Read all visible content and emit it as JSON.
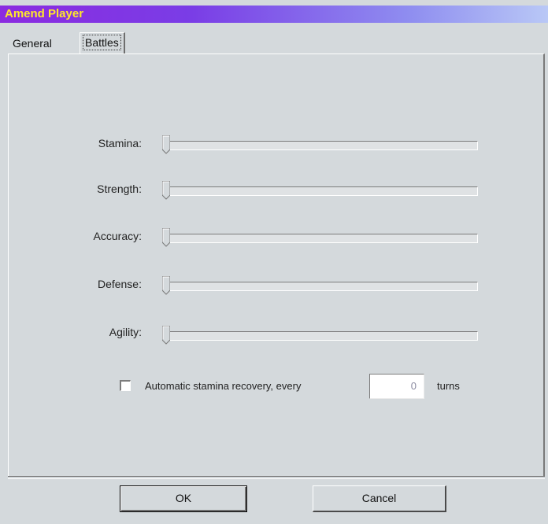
{
  "window": {
    "title": "Amend Player"
  },
  "tabs": [
    {
      "label": "General",
      "selected": false
    },
    {
      "label": "Battles",
      "selected": true
    }
  ],
  "sliders": [
    {
      "label": "Stamina:",
      "value": 0
    },
    {
      "label": "Strength:",
      "value": 0
    },
    {
      "label": "Accuracy:",
      "value": 0
    },
    {
      "label": "Defense:",
      "value": 0
    },
    {
      "label": "Agility:",
      "value": 0
    }
  ],
  "recovery": {
    "checked": false,
    "label": "Automatic stamina recovery, every",
    "value": "0",
    "suffix": "turns"
  },
  "buttons": {
    "ok": "OK",
    "cancel": "Cancel"
  },
  "colors": {
    "title_text": "#ffe82a",
    "title_start": "#8b2be0",
    "face": "#d4d9dc"
  }
}
